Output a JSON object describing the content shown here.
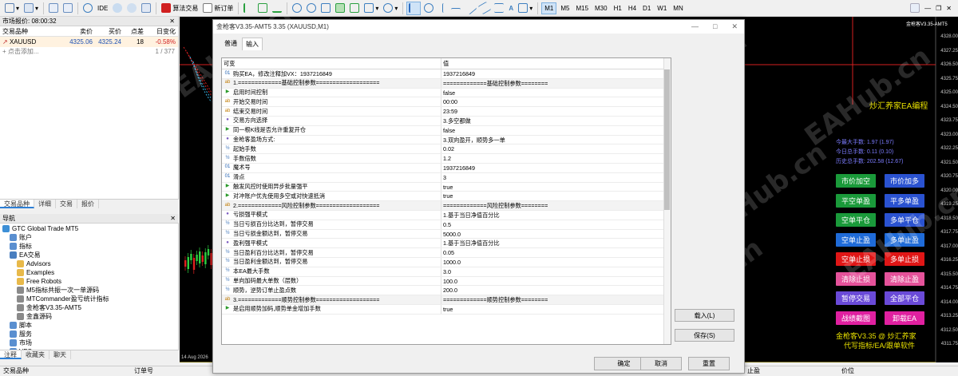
{
  "toolbar": {
    "ide_label": "IDE",
    "algo_label": "算法交易",
    "new_order_label": "新订单",
    "timeframes": [
      "M1",
      "M5",
      "M15",
      "M30",
      "H1",
      "H4",
      "D1",
      "W1",
      "MN"
    ],
    "active_timeframe": "M1"
  },
  "market_watch": {
    "title": "市场报价: 08:00:32",
    "headers": [
      "交易品种",
      "卖价",
      "买价",
      "点差",
      "日变化"
    ],
    "rows": [
      {
        "symbol": "XAUUSD",
        "bid": "4325.06",
        "ask": "4325.24",
        "spread": "18",
        "change": "-0.58%"
      }
    ],
    "add_label": "点击添加...",
    "count": "1 / 377",
    "tabs": [
      "交易品种",
      "详细",
      "交易",
      "报价"
    ],
    "colors": {
      "bid": "#1a4fb3",
      "change": "#d22020"
    }
  },
  "navigator": {
    "title": "导航",
    "items": [
      {
        "label": "GTC Global Trade MT5",
        "indent": 0,
        "icon": "broker-icon",
        "color": "#3d8fd6"
      },
      {
        "label": "账户",
        "indent": 1,
        "icon": "accounts-icon",
        "color": "#5a8fd0"
      },
      {
        "label": "指标",
        "indent": 1,
        "icon": "indicators-icon",
        "color": "#5a8fd0"
      },
      {
        "label": "EA交易",
        "indent": 1,
        "icon": "expert-advisors-icon",
        "color": "#4a7fc0"
      },
      {
        "label": "Advisors",
        "indent": 2,
        "icon": "folder-icon",
        "color": "#e8b94a"
      },
      {
        "label": "Examples",
        "indent": 2,
        "icon": "folder-icon",
        "color": "#e8b94a"
      },
      {
        "label": "Free Robots",
        "indent": 2,
        "icon": "folder-icon",
        "color": "#e8b94a"
      },
      {
        "label": "M5指标共振一次一单源码",
        "indent": 2,
        "icon": "ea-file-icon",
        "color": "#8a8a8a"
      },
      {
        "label": "MTCommander盈亏统计指标",
        "indent": 2,
        "icon": "ea-file-icon",
        "color": "#8a8a8a"
      },
      {
        "label": "金枪客V3.35-AMT5",
        "indent": 2,
        "icon": "ea-file-icon",
        "color": "#8a8a8a"
      },
      {
        "label": "金鑫源码",
        "indent": 2,
        "icon": "ea-file-icon",
        "color": "#8a8a8a"
      },
      {
        "label": "脚本",
        "indent": 1,
        "icon": "scripts-icon",
        "color": "#5a8fd0"
      },
      {
        "label": "服务",
        "indent": 1,
        "icon": "services-icon",
        "color": "#5a8fd0"
      },
      {
        "label": "市场",
        "indent": 1,
        "icon": "market-icon",
        "color": "#5a8fd0"
      },
      {
        "label": "VPS",
        "indent": 1,
        "icon": "vps-icon",
        "color": "#5a8fd0"
      }
    ],
    "tabs": [
      "注释",
      "收藏夹",
      "聊天"
    ]
  },
  "bottom_bar": {
    "left": "交易品种",
    "mid": "订单号",
    "right1": "止盈",
    "right2": "价位"
  },
  "chart": {
    "label": "金枪客V3.35-AMT5",
    "date_label": "14 Aug 2026",
    "brand": "炒汇养家EA编程",
    "stats": [
      "今最大手数: 1.97 (1.97)",
      "今日总手数: 0.11 (0.10)",
      "历史总手数: 202.58 (12.67)"
    ],
    "buttons": [
      {
        "label": "市价加空",
        "bg": "#1a9a3a"
      },
      {
        "label": "市价加多",
        "bg": "#2a52d0"
      },
      {
        "label": "平空单盈",
        "bg": "#1a9a3a"
      },
      {
        "label": "平多单盈",
        "bg": "#2a52d0"
      },
      {
        "label": "空单平仓",
        "bg": "#1a9a3a"
      },
      {
        "label": "多单平仓",
        "bg": "#2a52d0"
      },
      {
        "label": "空单止盈",
        "bg": "#1f6bd8"
      },
      {
        "label": "多单止盈",
        "bg": "#1f6bd8"
      },
      {
        "label": "空单止损",
        "bg": "#e01616"
      },
      {
        "label": "多单止损",
        "bg": "#e01616"
      },
      {
        "label": "清除止损",
        "bg": "#e5529a"
      },
      {
        "label": "清除止盈",
        "bg": "#e5529a"
      },
      {
        "label": "暂停交易",
        "bg": "#6a4ad8"
      },
      {
        "label": "全部平仓",
        "bg": "#6a4ad8"
      },
      {
        "label": "战绩截图",
        "bg": "#e020a0"
      },
      {
        "label": "卸载EA",
        "bg": "#e020a0"
      }
    ],
    "footer": [
      "金枪客V3.35 @ 炒汇养家",
      "代写指标/EA/跟单软件"
    ],
    "prices": [
      "4328.00",
      "4327.25",
      "4326.50",
      "4325.75",
      "4325.00",
      "4324.50",
      "4323.75",
      "4323.00",
      "4322.25",
      "4321.50",
      "4320.75",
      "4320.00",
      "4319.25",
      "4318.50",
      "4317.75",
      "4317.00",
      "4316.25",
      "4315.50",
      "4314.75",
      "4314.00",
      "4313.25",
      "4312.50",
      "4311.75"
    ],
    "watermark": "EAHub.cn"
  },
  "dialog": {
    "title": "金枪客V3.35-AMT5 3.35 (XAUUSD,M1)",
    "tabs": [
      "普通",
      "输入"
    ],
    "col_var": "可变",
    "col_val": "值",
    "params": [
      {
        "icon": "01",
        "name": "购买EA，修改注释加VX：1937216849",
        "value": "1937216849"
      },
      {
        "icon": "ab",
        "name": "1.=============基础控制参数===================",
        "value": "=============基础控制参数========",
        "gray": true
      },
      {
        "icon": "flag",
        "name": "启用时间控制",
        "value": "false"
      },
      {
        "icon": "ab",
        "name": "开始交易时间",
        "value": "00:00"
      },
      {
        "icon": "ab",
        "name": "结束交易时间",
        "value": "23:59"
      },
      {
        "icon": "enum",
        "name": "交易方向选择",
        "value": "3.多空都做"
      },
      {
        "icon": "flag",
        "name": "同一根K线是否允许重复开仓",
        "value": "false"
      },
      {
        "icon": "enum",
        "name": "金枪客盈场方式:",
        "value": "3.双向盈开，顺势多一单"
      },
      {
        "icon": "v2",
        "name": "起始手数",
        "value": "0.02"
      },
      {
        "icon": "v2",
        "name": "手数倍数",
        "value": "1.2"
      },
      {
        "icon": "01",
        "name": "魔术号",
        "value": "1937216849"
      },
      {
        "icon": "01",
        "name": "滑点",
        "value": "3"
      },
      {
        "icon": "flag",
        "name": "触发风控时使用异步批量强平",
        "value": "true"
      },
      {
        "icon": "flag",
        "name": "对冲账户优先使用多空或对快速抵消",
        "value": "true"
      },
      {
        "icon": "ab",
        "name": "2.=============风险控制参数===================",
        "value": "=============风险控制参数========",
        "gray": true
      },
      {
        "icon": "enum",
        "name": "亏损强平模式",
        "value": "1.基于当日净值百分比"
      },
      {
        "icon": "v2",
        "name": "当日亏损百分比达到，暂停交易",
        "value": "0.5"
      },
      {
        "icon": "v2",
        "name": "当日亏损金额达到，暂停交易",
        "value": "5000.0"
      },
      {
        "icon": "enum",
        "name": "盈利强平模式",
        "value": "1.基于当日净值百分比"
      },
      {
        "icon": "v2",
        "name": "当日盈利百分比达到，暂停交易",
        "value": "0.05"
      },
      {
        "icon": "v2",
        "name": "当日盈利金额达到，暂停交易",
        "value": "1000.0"
      },
      {
        "icon": "v2",
        "name": "本EA最大手数",
        "value": "3.0"
      },
      {
        "icon": "v2",
        "name": "单向加码最大单数（层数）",
        "value": "100.0"
      },
      {
        "icon": "v2",
        "name": "顺势，逆势订单止盈点数",
        "value": "200.0"
      },
      {
        "icon": "ab",
        "name": "3.=============顺势控制参数===================",
        "value": "=============顺势控制参数========",
        "gray": true
      },
      {
        "icon": "flag",
        "name": "是启用顺势加码,顺势单金增加手数",
        "value": "true"
      }
    ],
    "load_label": "载入(L)",
    "save_label": "保存(S)",
    "ok_label": "确定",
    "cancel_label": "取消",
    "reset_label": "重置"
  }
}
